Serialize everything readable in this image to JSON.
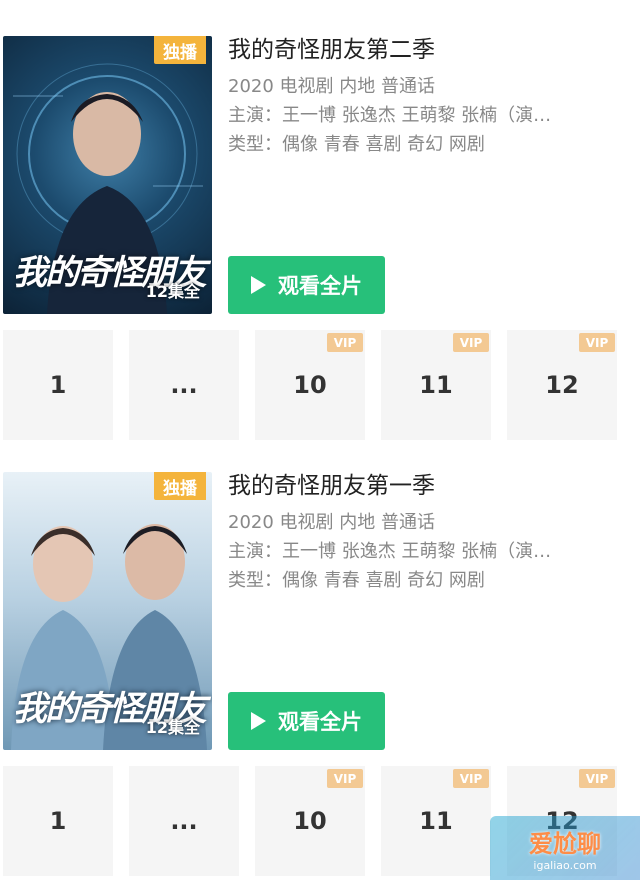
{
  "shows": [
    {
      "badge": "独播",
      "poster_title": "我的奇怪朋友",
      "poster_episodes": "12集全",
      "title": "我的奇怪朋友第二季",
      "meta": "2020 电视剧 内地 普通话",
      "cast": "主演：王一博 张逸杰 王萌黎 张楠（演…",
      "genre": "类型：偶像 青春 喜剧 奇幻 网剧",
      "watch_label": "观看全片",
      "episodes": [
        {
          "label": "1",
          "vip": ""
        },
        {
          "label": "...",
          "vip": ""
        },
        {
          "label": "10",
          "vip": "VIP"
        },
        {
          "label": "11",
          "vip": "VIP"
        },
        {
          "label": "12",
          "vip": "VIP"
        }
      ]
    },
    {
      "badge": "独播",
      "poster_title": "我的奇怪朋友",
      "poster_episodes": "12集全",
      "title": "我的奇怪朋友第一季",
      "meta": "2020 电视剧 内地 普通话",
      "cast": "主演：王一博 张逸杰 王萌黎 张楠（演…",
      "genre": "类型：偶像 青春 喜剧 奇幻 网剧",
      "watch_label": "观看全片",
      "episodes": [
        {
          "label": "1",
          "vip": ""
        },
        {
          "label": "...",
          "vip": ""
        },
        {
          "label": "10",
          "vip": "VIP"
        },
        {
          "label": "11",
          "vip": "VIP"
        },
        {
          "label": "12",
          "vip": "VIP"
        }
      ]
    }
  ],
  "watermark": {
    "main": "爱尬聊",
    "url": "igaliao.com"
  }
}
